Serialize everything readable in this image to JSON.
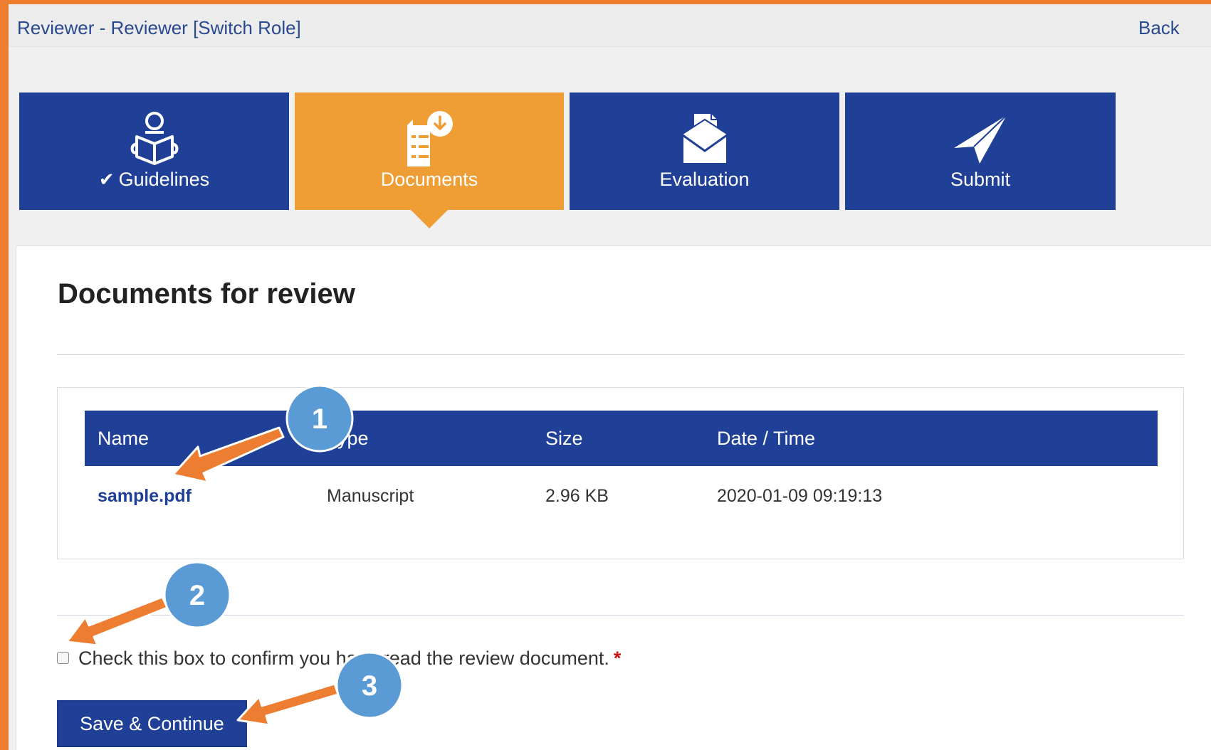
{
  "topbar": {
    "title": "Reviewer - Reviewer [Switch Role]",
    "back_label": "Back"
  },
  "steps": [
    {
      "label": "Guidelines",
      "icon": "reader-book-icon",
      "completed": true,
      "active": false
    },
    {
      "label": "Documents",
      "icon": "document-download-icon",
      "completed": false,
      "active": true
    },
    {
      "label": "Evaluation",
      "icon": "envelope-document-icon",
      "completed": false,
      "active": false
    },
    {
      "label": "Submit",
      "icon": "paper-plane-icon",
      "completed": false,
      "active": false
    }
  ],
  "panel": {
    "title": "Documents for review",
    "table": {
      "headers": [
        "Name",
        "Type",
        "Size",
        "Date / Time"
      ],
      "rows": [
        {
          "name": "sample.pdf",
          "type": "Manuscript",
          "size": "2.96 KB",
          "datetime": "2020-01-09 09:19:13"
        }
      ]
    },
    "confirm": {
      "label": "Check this box to confirm you have read the review document.",
      "required_mark": "*",
      "checked": false
    },
    "save_label": "Save & Continue"
  },
  "annotations": {
    "badges": [
      "1",
      "2",
      "3"
    ],
    "badge_color": "#5B9BD5",
    "arrow_color": "#ED7D31"
  },
  "colors": {
    "primary": "#1f4096",
    "active_step": "#EE9E35",
    "frame": "#ED7D31"
  }
}
